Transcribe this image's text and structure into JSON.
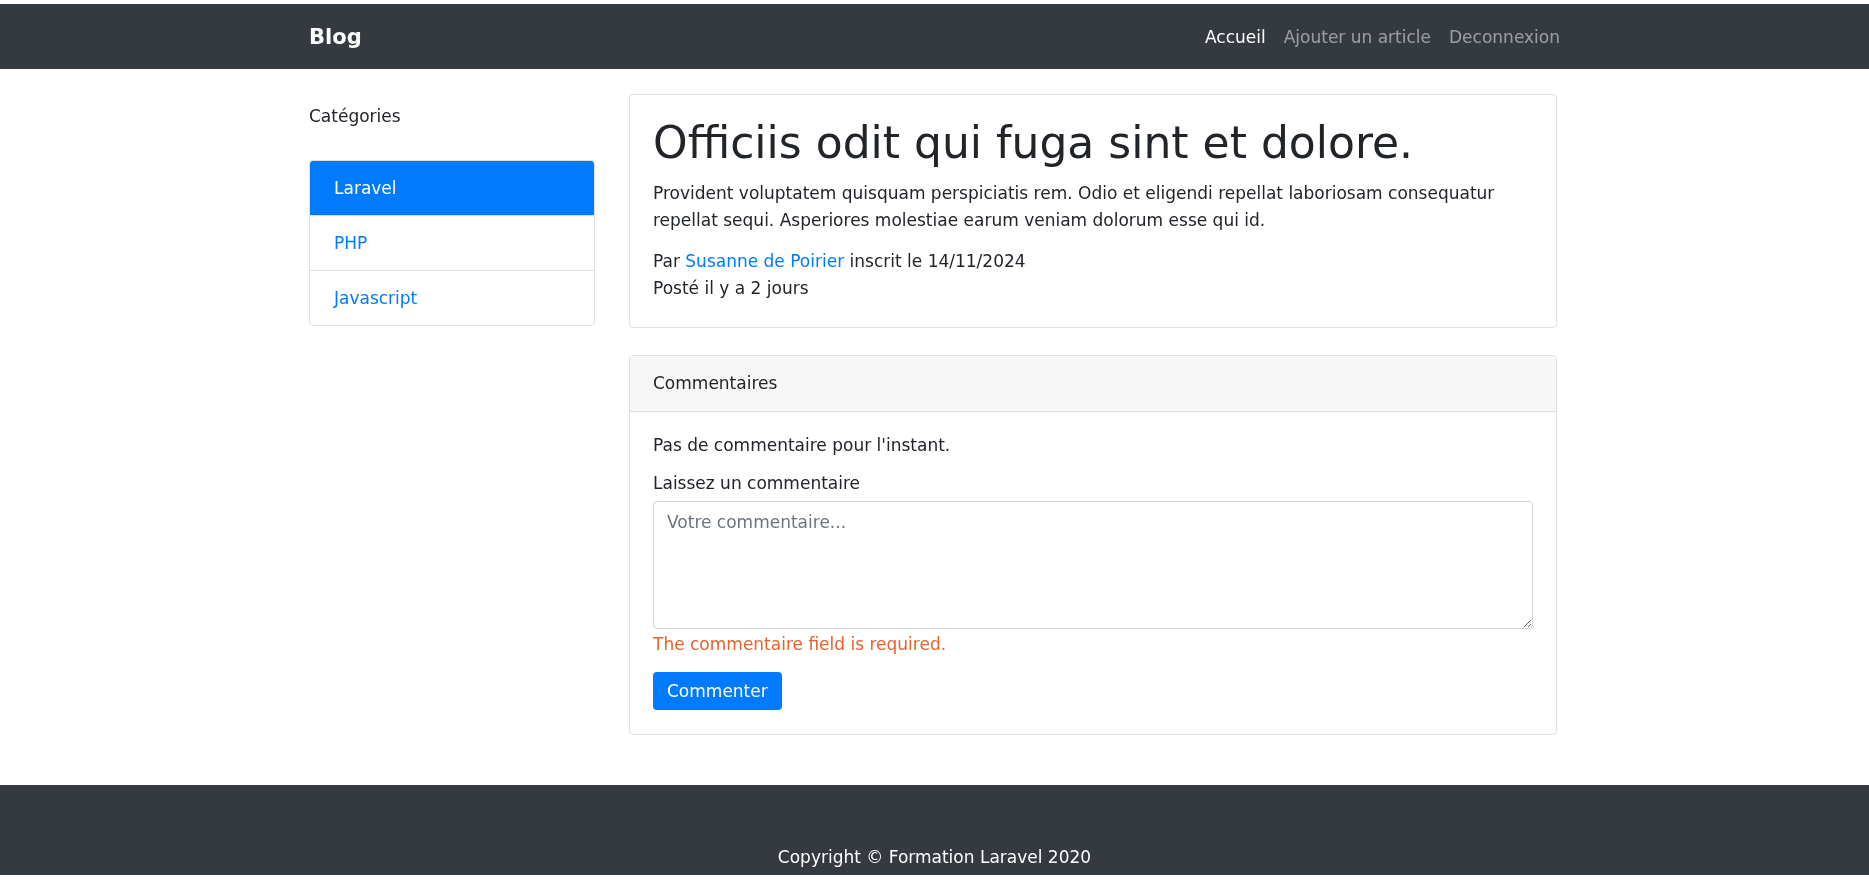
{
  "navbar": {
    "brand": "Blog",
    "links": [
      {
        "label": "Accueil",
        "selected": true
      },
      {
        "label": "Ajouter un article",
        "selected": false
      },
      {
        "label": "Deconnexion",
        "selected": false
      }
    ]
  },
  "sidebar": {
    "title": "Catégories",
    "items": [
      {
        "label": "Laravel",
        "selected": true
      },
      {
        "label": "PHP",
        "selected": false
      },
      {
        "label": "Javascript",
        "selected": false
      }
    ]
  },
  "article": {
    "title": "Officiis odit qui fuga sint et dolore.",
    "body": "Provident voluptatem quisquam perspiciatis rem. Odio et eligendi repellat laboriosam consequatur repellat sequi. Asperiores molestiae earum veniam dolorum esse qui id.",
    "author_prefix": "Par",
    "author": "Susanne de Poirier",
    "author_suffix": "inscrit le 14/11/2024",
    "posted": "Posté il y a 2 jours"
  },
  "comments": {
    "header": "Commentaires",
    "empty_text": "Pas de commentaire pour l'instant.",
    "form_label": "Laissez un commentaire",
    "placeholder": "Votre commentaire...",
    "error": "The commentaire field is required.",
    "submit": "Commenter"
  },
  "footer": {
    "copyright": "Copyright © Formation Laravel 2020"
  }
}
